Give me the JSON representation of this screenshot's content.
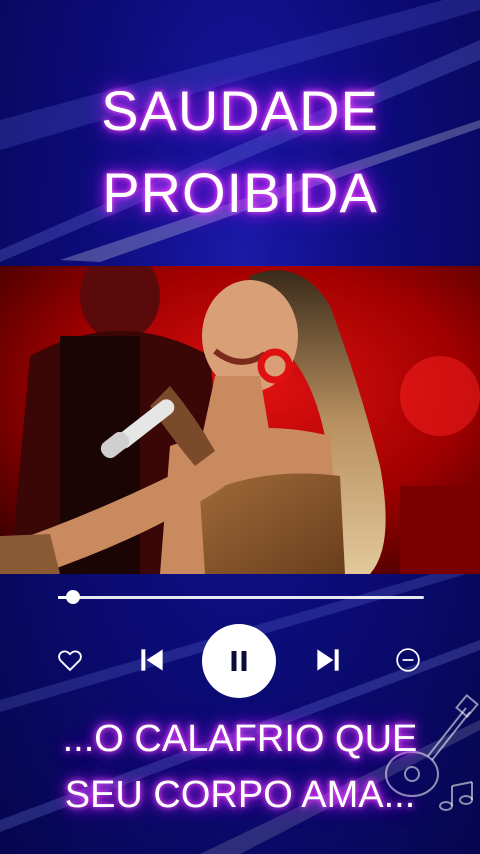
{
  "title": {
    "line1": "SAUDADE",
    "line2": "PROIBIDA"
  },
  "player": {
    "progress_fraction": 0.04,
    "icons": [
      "heart-icon",
      "skip-previous-icon",
      "pause-icon",
      "skip-next-icon",
      "minus-circle-icon"
    ]
  },
  "lyrics": {
    "line1": "...O CALAFRIO QUE",
    "line2": "SEU CORPO AMA..."
  },
  "colors": {
    "background": "#0c0c7a",
    "glow": "#d12bff",
    "text": "#ffffff",
    "stage_red": "#c40000"
  }
}
